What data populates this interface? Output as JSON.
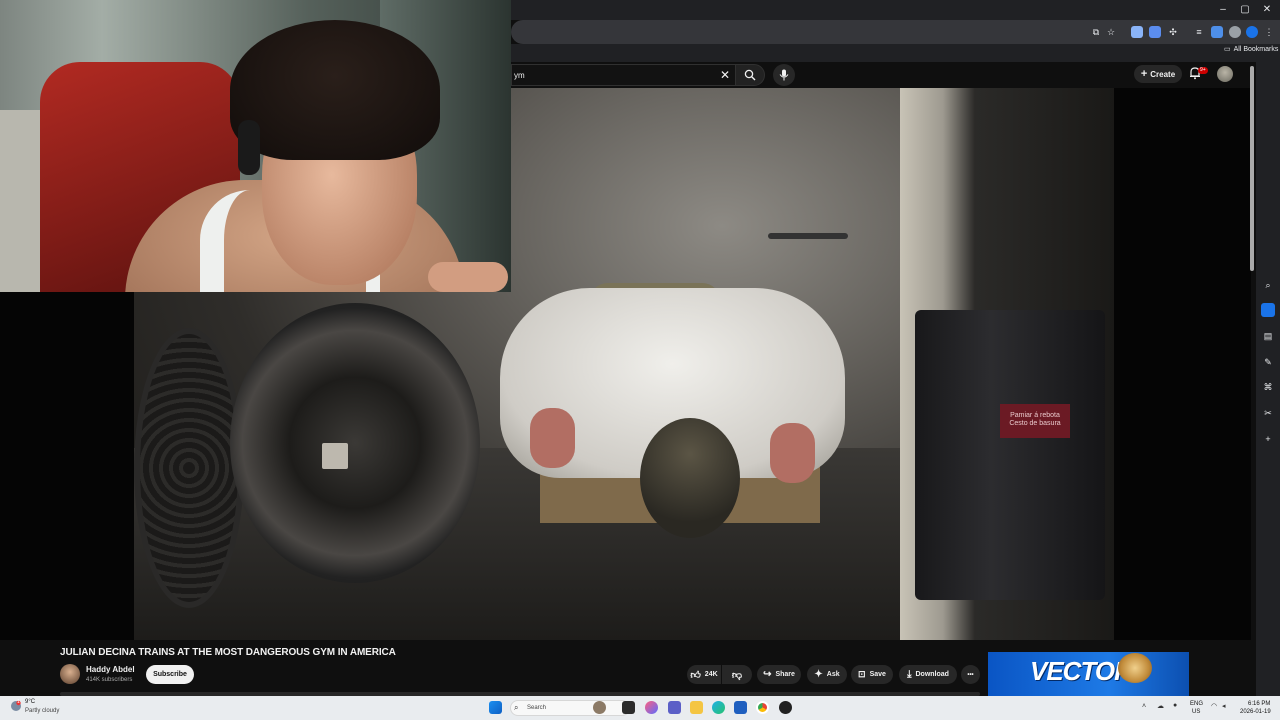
{
  "browser": {
    "window_controls": {
      "minimize": "–",
      "maximize": "▢",
      "close": "✕"
    },
    "bookmarks_label": "All Bookmarks"
  },
  "youtube": {
    "search_value": "ym",
    "create_label": "Create",
    "notification_badge": "9+",
    "video": {
      "title": "JULIAN DECINA TRAINS AT THE MOST DANGEROUS GYM IN AMERICA",
      "channel": "Haddy Abdel",
      "subscribers": "414K subscribers",
      "subscribe_label": "Subscribe",
      "like_count": "24K",
      "share_label": "Share",
      "ask_label": "Ask",
      "save_label": "Save",
      "download_label": "Download",
      "more_label": "•••",
      "scene_sign_text": "Pamiar á rebota Cesto de basura"
    },
    "ad": {
      "brand_text": "VECTOR"
    }
  },
  "taskbar": {
    "weather_temp": "9°C",
    "weather_desc": "Partly cloudy",
    "weather_badge": "1",
    "search_placeholder": "Search",
    "lang_top": "ENG",
    "lang_bottom": "US",
    "time": "6:16 PM",
    "date": "2026-01-19"
  },
  "colors": {
    "yt_bg": "#0f0f0f",
    "accent_red": "#cc0000",
    "ad_blue": "#1e7ae6",
    "taskbar_bg": "#e9ecef"
  }
}
